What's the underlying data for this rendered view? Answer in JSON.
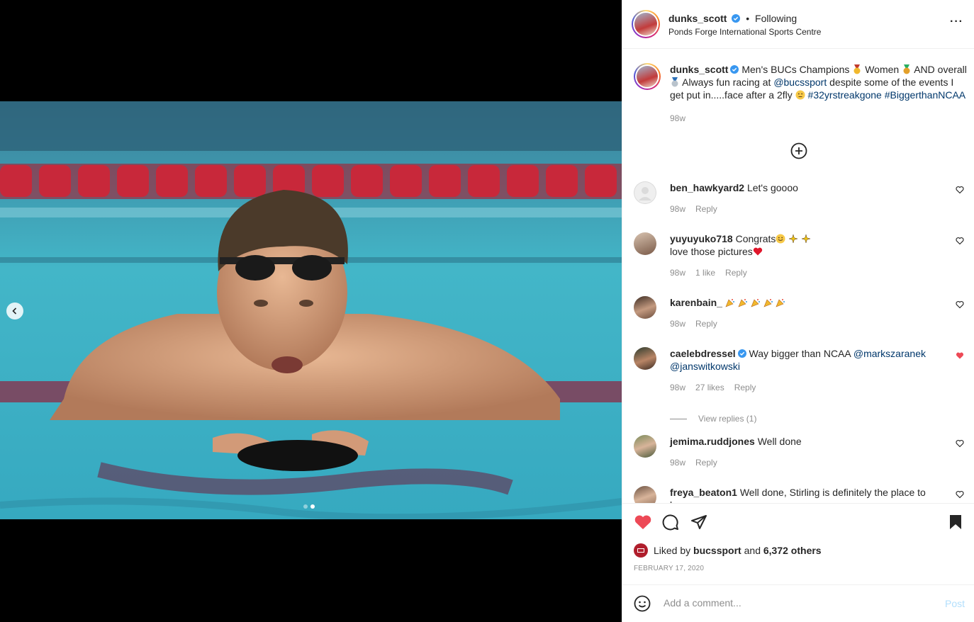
{
  "post": {
    "author": "dunks_scott",
    "follow_separator": "•",
    "follow_status": "Following",
    "location": "Ponds Forge International Sports Centre",
    "more_label": "···",
    "caption": {
      "part1": "Men's BUCs Champions",
      "part2": "Women",
      "part3": "AND overall",
      "part4": "Always fun racing at",
      "mention": "@bucssport",
      "part5": "despite some of the events I get put in.....face after a 2fly",
      "hashtags": "#32yrstreakgone #BiggerthanNCAA",
      "age": "98w"
    },
    "photo_alt": "Swimmer resting on lane rope in pool",
    "carousel": {
      "total": 2,
      "active": 2
    }
  },
  "comments": [
    {
      "user": "ben_hawkyard2",
      "text": "Let's goooo",
      "age": "98w",
      "likes": "",
      "reply": "Reply",
      "liked": false
    },
    {
      "user": "yuyuyuko718",
      "text": "Congrats",
      "text2": "love those pictures",
      "age": "98w",
      "likes": "1 like",
      "reply": "Reply",
      "liked": false
    },
    {
      "user": "karenbain_",
      "text": "",
      "age": "98w",
      "likes": "",
      "reply": "Reply",
      "liked": false
    },
    {
      "user": "caelebdressel",
      "text": "Way bigger than NCAA",
      "mention1": "@markszaranek",
      "mention2": "@janswitkowski",
      "age": "98w",
      "likes": "27 likes",
      "reply": "Reply",
      "liked": true,
      "view_replies": "View replies (1)"
    },
    {
      "user": "jemima.ruddjones",
      "text": "Well done",
      "age": "98w",
      "likes": "",
      "reply": "Reply",
      "liked": false
    },
    {
      "user": "freya_beaton1",
      "text": "Well done, Stirling is definitely the place to be,",
      "age": "",
      "likes": "",
      "reply": "",
      "liked": false
    }
  ],
  "actions": {
    "liked_by_prefix": "Liked by",
    "liked_by_user": "bucssport",
    "liked_by_and": "and",
    "liked_by_others": "6,372 others",
    "date": "FEBRUARY 17, 2020"
  },
  "add_comment": {
    "placeholder": "Add a comment...",
    "post_label": "Post"
  },
  "colors": {
    "like_red": "#ed4956",
    "link_blue": "#00376b",
    "verified_blue": "#3897f0",
    "post_disabled": "#b2dffc"
  }
}
